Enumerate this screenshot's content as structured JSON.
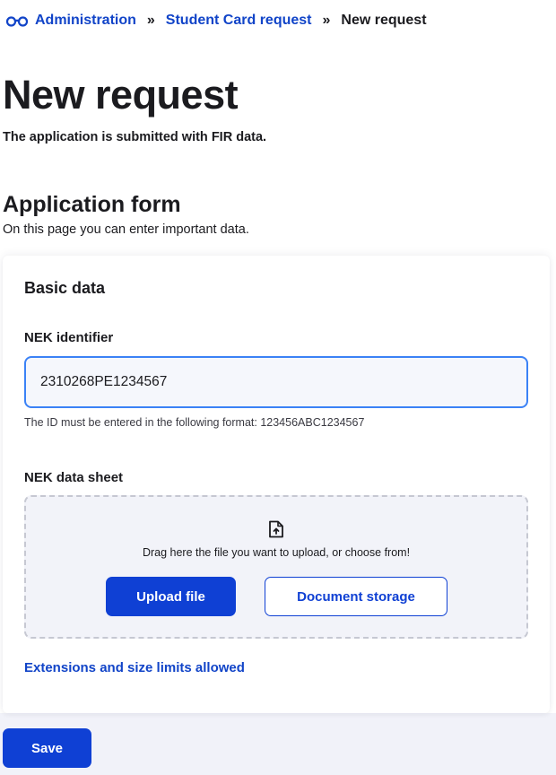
{
  "breadcrumb": {
    "icon": "glasses-icon",
    "items": [
      "Administration",
      "Student Card request"
    ],
    "separator": "»",
    "current": "New request"
  },
  "header": {
    "title": "New request",
    "subtitle": "The application is submitted with FIR data."
  },
  "section": {
    "title": "Application form",
    "description": "On this page you can enter important data."
  },
  "form": {
    "heading": "Basic data",
    "nek_identifier": {
      "label": "NEK identifier",
      "value": "2310268PE1234567",
      "help": "The ID must be entered in the following format: 123456ABC1234567"
    },
    "nek_data_sheet": {
      "label": "NEK data sheet",
      "icon": "file-upload-icon",
      "dropzone_text": "Drag here the file you want to upload, or choose from!",
      "upload_button": "Upload file",
      "storage_button": "Document storage"
    },
    "limits_link": "Extensions and size limits allowed"
  },
  "actions": {
    "save_label": "Save"
  },
  "colors": {
    "primary": "#0f40d4",
    "link": "#1144c8",
    "input_focus_border": "#3b82f6",
    "bottom_band": "#f1f2f9"
  }
}
